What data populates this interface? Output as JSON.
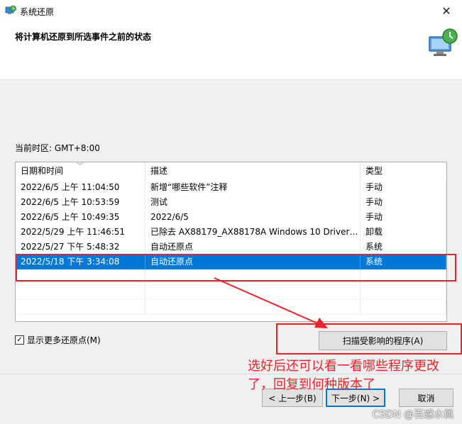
{
  "window": {
    "title": "系统还原",
    "close_glyph": "✕"
  },
  "header": {
    "title": "将计算机还原到所选事件之前的状态",
    "icon": "system-restore-icon"
  },
  "timezone_label": "当前时区: GMT+8:00",
  "list": {
    "columns": [
      "日期和时间",
      "描述",
      "类型"
    ],
    "rows": [
      {
        "date": "2022/6/5 上午 11:04:50",
        "desc": "新增“哪些软件”注释",
        "type": "手动"
      },
      {
        "date": "2022/6/5 上午 10:53:59",
        "desc": "测试",
        "type": "手动"
      },
      {
        "date": "2022/6/5 上午 10:49:35",
        "desc": "2022/6/5",
        "type": "手动"
      },
      {
        "date": "2022/5/29 上午 11:46:51",
        "desc": "已除去 AX88179_AX88178A Windows 10 Drivers ...",
        "type": "卸载"
      },
      {
        "date": "2022/5/27 下午 5:48:32",
        "desc": "自动还原点",
        "type": "系统"
      },
      {
        "date": "2022/5/18 下午 3:34:08",
        "desc": "自动还原点",
        "type": "系统"
      }
    ],
    "selected_index": 5
  },
  "checkbox": {
    "label": "显示更多还原点(M)",
    "checked": true
  },
  "buttons": {
    "scan": "扫描受影响的程序(A)",
    "back": "< 上一步(B)",
    "next": "下一步(N) >",
    "cancel": "取消"
  },
  "annotation": "选好后还可以看一看哪些程序更改了，回复到何种版本了",
  "watermark": "CSDN @百感水佩",
  "colors": {
    "selection": "#0078d7",
    "annotation": "#e8232a"
  }
}
